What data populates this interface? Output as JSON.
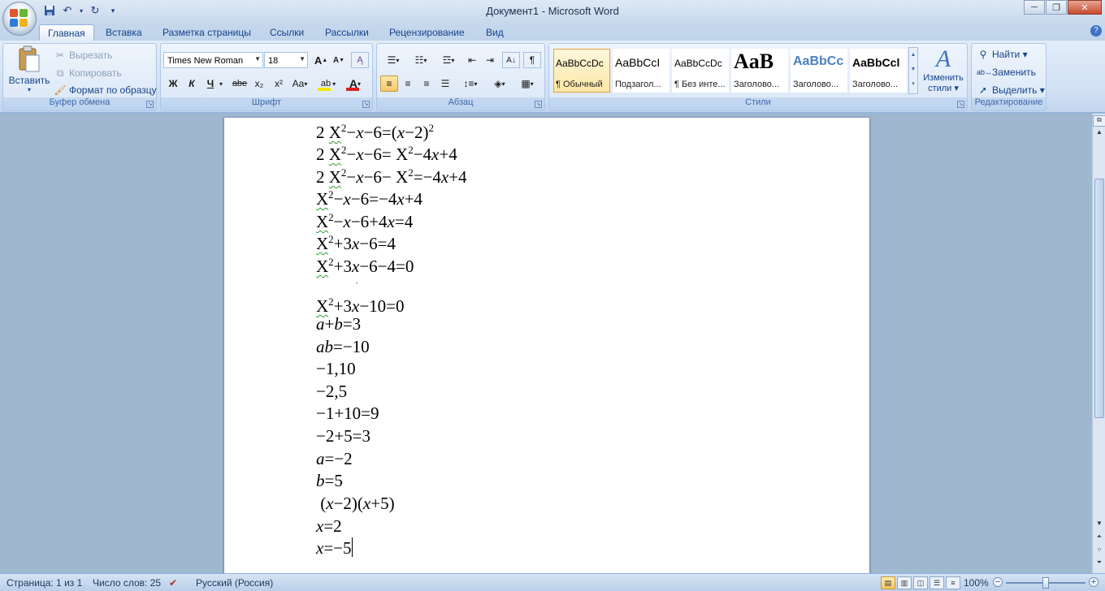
{
  "window": {
    "title": "Документ1 - Microsoft Word",
    "controls": {
      "minimize": "─",
      "maximize": "❐",
      "close": "✕"
    }
  },
  "quick_access": [
    {
      "name": "save-icon",
      "glyph": "💾"
    },
    {
      "name": "undo-icon",
      "glyph": "↶"
    },
    {
      "name": "dropdown-arrow-icon",
      "glyph": "▾"
    },
    {
      "name": "redo-icon",
      "glyph": "↻"
    },
    {
      "name": "customize-qat-icon",
      "glyph": "⩡"
    }
  ],
  "tabs": [
    "Главная",
    "Вставка",
    "Разметка страницы",
    "Ссылки",
    "Рассылки",
    "Рецензирование",
    "Вид"
  ],
  "help_glyph": "?",
  "clipboard": {
    "group_label": "Буфер обмена",
    "paste_label": "Вставить",
    "cut_label": "Вырезать",
    "copy_label": "Копировать",
    "format_painter_label": "Формат по образцу"
  },
  "font": {
    "group_label": "Шрифт",
    "font_name": "Times New Roman",
    "font_size": "18",
    "bold": "Ж",
    "italic": "К",
    "underline": "Ч",
    "strikethrough": "abe",
    "subscript": "x₂",
    "superscript": "x²",
    "change_case": "Aa",
    "grow_font": "A",
    "shrink_font": "A",
    "clear_format": "⌫",
    "highlight": "ab",
    "font_color": "A",
    "highlight_color": "#f5e500",
    "font_color_value": "#e02020"
  },
  "paragraph": {
    "group_label": "Абзац",
    "show_marks": "¶"
  },
  "styles": {
    "group_label": "Стили",
    "items": [
      {
        "preview": "AaBbCcDc",
        "name": "¶ Обычный"
      },
      {
        "preview": "AaBbCcI",
        "name": "Подзагол..."
      },
      {
        "preview": "AaBbCcDc",
        "name": "¶ Без инте..."
      },
      {
        "preview": "AaB",
        "name": "Заголово..."
      },
      {
        "preview": "AaBbCc",
        "name": "Заголово..."
      },
      {
        "preview": "AaBbCcl",
        "name": "Заголово..."
      }
    ],
    "change_styles_line1": "Изменить",
    "change_styles_line2": "стили ▾"
  },
  "editing": {
    "group_label": "Редактирование",
    "find_label": "Найти ▾",
    "replace_label": "Заменить",
    "select_label": "Выделить ▾"
  },
  "document_lines": [
    {
      "parts": [
        [
          "t",
          "2 "
        ],
        [
          "sq",
          "X"
        ],
        [
          "sup",
          "2"
        ],
        [
          "t",
          "−"
        ],
        [
          "i",
          "x"
        ],
        [
          "t",
          "−6=("
        ],
        [
          "i",
          "x"
        ],
        [
          "t",
          "−2)"
        ],
        [
          "sup",
          "2"
        ]
      ]
    },
    {
      "parts": [
        [
          "t",
          "2 "
        ],
        [
          "sq",
          "X"
        ],
        [
          "sup",
          "2"
        ],
        [
          "t",
          "−"
        ],
        [
          "i",
          "x"
        ],
        [
          "t",
          "−6= X"
        ],
        [
          "sup",
          "2"
        ],
        [
          "t",
          "−4"
        ],
        [
          "i",
          "x"
        ],
        [
          "t",
          "+4"
        ]
      ]
    },
    {
      "parts": [
        [
          "t",
          "2 "
        ],
        [
          "sq",
          "X"
        ],
        [
          "sup",
          "2"
        ],
        [
          "t",
          "−"
        ],
        [
          "i",
          "x"
        ],
        [
          "t",
          "−6− X"
        ],
        [
          "sup",
          "2"
        ],
        [
          "t",
          "=−4"
        ],
        [
          "i",
          "x"
        ],
        [
          "t",
          "+4"
        ]
      ]
    },
    {
      "parts": [
        [
          "sq",
          "X"
        ],
        [
          "sup",
          "2"
        ],
        [
          "t",
          "−"
        ],
        [
          "i",
          "x"
        ],
        [
          "t",
          "−6=−4"
        ],
        [
          "i",
          "x"
        ],
        [
          "t",
          "+4"
        ]
      ]
    },
    {
      "parts": [
        [
          "sq",
          "X"
        ],
        [
          "sup",
          "2"
        ],
        [
          "t",
          "−"
        ],
        [
          "i",
          "x"
        ],
        [
          "t",
          "−6+4"
        ],
        [
          "i",
          "x"
        ],
        [
          "t",
          "=4"
        ]
      ]
    },
    {
      "parts": [
        [
          "sq",
          "X"
        ],
        [
          "sup",
          "2"
        ],
        [
          "t",
          "+3"
        ],
        [
          "i",
          "x"
        ],
        [
          "t",
          "−6=4"
        ]
      ]
    },
    {
      "parts": [
        [
          "sq",
          "X"
        ],
        [
          "sup",
          "2"
        ],
        [
          "t",
          "+3"
        ],
        [
          "i",
          "x"
        ],
        [
          "t",
          "−6−4=0"
        ]
      ]
    },
    {
      "parts": [
        [
          "t",
          "."
        ]
      ]
    },
    {
      "parts": [
        [
          "sq",
          "X"
        ],
        [
          "sup",
          "2"
        ],
        [
          "t",
          "+3"
        ],
        [
          "i",
          "x"
        ],
        [
          "t",
          "−10=0"
        ]
      ]
    },
    {
      "parts": [
        [
          "i",
          "a"
        ],
        [
          "t",
          "+"
        ],
        [
          "i",
          "b"
        ],
        [
          "t",
          "=3"
        ]
      ]
    },
    {
      "parts": [
        [
          "i",
          "ab"
        ],
        [
          "t",
          "=−10"
        ]
      ]
    },
    {
      "parts": [
        [
          "t",
          "−1,10"
        ]
      ]
    },
    {
      "parts": [
        [
          "t",
          "−2,5"
        ]
      ]
    },
    {
      "parts": [
        [
          "t",
          "−1+10=9"
        ]
      ]
    },
    {
      "parts": [
        [
          "t",
          "−2+5=3"
        ]
      ]
    },
    {
      "parts": [
        [
          "i",
          "a"
        ],
        [
          "t",
          "=−2"
        ]
      ]
    },
    {
      "parts": [
        [
          "i",
          "b"
        ],
        [
          "t",
          "=5"
        ]
      ]
    },
    {
      "parts": [
        [
          "t",
          " ("
        ],
        [
          "i",
          "x"
        ],
        [
          "t",
          "−2)("
        ],
        [
          "i",
          "x"
        ],
        [
          "t",
          "+5)"
        ]
      ]
    },
    {
      "parts": [
        [
          "i",
          "x"
        ],
        [
          "t",
          "=2"
        ]
      ]
    },
    {
      "parts": [
        [
          "i",
          "x"
        ],
        [
          "t",
          "=−5"
        ],
        [
          "caret",
          ""
        ]
      ]
    }
  ],
  "status": {
    "page": "Страница: 1 из 1",
    "words": "Число слов: 25",
    "language": "Русский (Россия)",
    "zoom": "100%",
    "zoom_minus": "−",
    "zoom_plus": "+"
  }
}
